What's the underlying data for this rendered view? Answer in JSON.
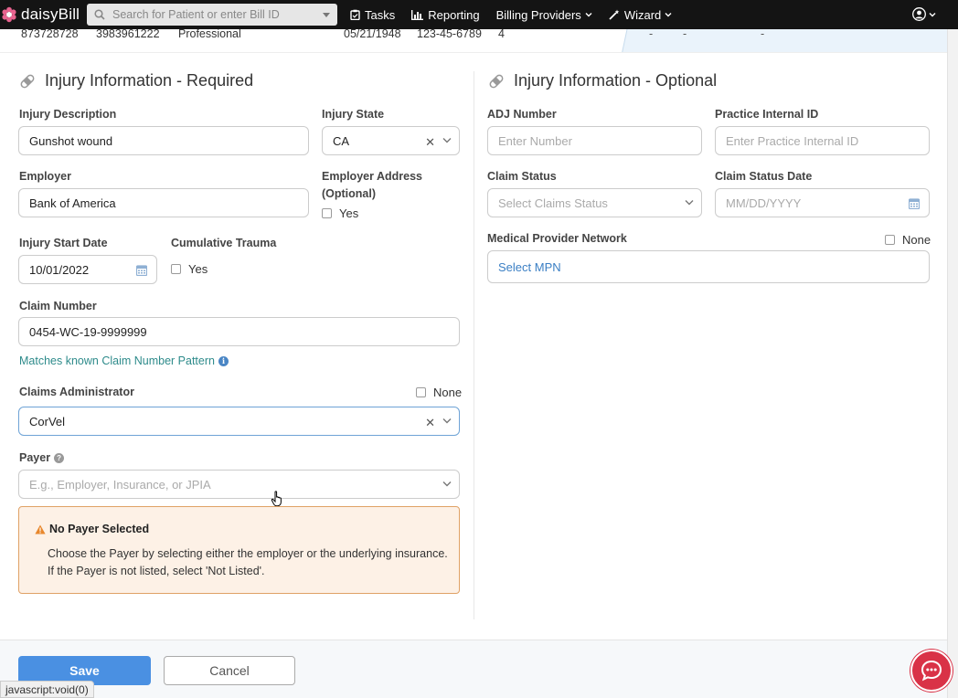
{
  "nav": {
    "brand": "daisyBill",
    "search_placeholder": "Search for Patient or enter Bill ID",
    "links": {
      "tasks": "Tasks",
      "reporting": "Reporting",
      "billing_providers": "Billing Providers",
      "wizard": "Wizard"
    }
  },
  "strip": {
    "cells": [
      "873728728",
      "3983961222",
      "Professional",
      "05/21/1948",
      "123-45-6789",
      "4"
    ],
    "dashes": [
      "-",
      "-",
      "-"
    ]
  },
  "required": {
    "title": "Injury Information - Required",
    "injury_description": {
      "label": "Injury Description",
      "value": "Gunshot wound"
    },
    "injury_state": {
      "label": "Injury State",
      "value": "CA"
    },
    "employer": {
      "label": "Employer",
      "value": "Bank of America"
    },
    "employer_address": {
      "label_line1": "Employer Address",
      "label_line2": "(Optional)",
      "checkbox": "Yes"
    },
    "injury_start_date": {
      "label": "Injury Start Date",
      "value": "10/01/2022"
    },
    "cumulative_trauma": {
      "label": "Cumulative Trauma",
      "checkbox": "Yes"
    },
    "claim_number": {
      "label": "Claim Number",
      "value": "0454-WC-19-9999999",
      "hint": "Matches known Claim Number Pattern"
    },
    "claims_administrator": {
      "label": "Claims Administrator",
      "value": "CorVel",
      "none_label": "None"
    },
    "payer": {
      "label": "Payer",
      "placeholder": "E.g., Employer, Insurance, or JPIA"
    },
    "warning": {
      "title": "No Payer Selected",
      "body": "Choose the Payer by selecting either the employer or the underlying insurance. If the Payer is not listed, select 'Not Listed'."
    }
  },
  "optional": {
    "title": "Injury Information - Optional",
    "adj_number": {
      "label": "ADJ Number",
      "placeholder": "Enter Number"
    },
    "practice_internal_id": {
      "label": "Practice Internal ID",
      "placeholder": "Enter Practice Internal ID"
    },
    "claim_status": {
      "label": "Claim Status",
      "placeholder": "Select Claims Status"
    },
    "claim_status_date": {
      "label": "Claim Status Date",
      "placeholder": "MM/DD/YYYY"
    },
    "mpn": {
      "label": "Medical Provider Network",
      "none_label": "None",
      "value": "Select MPN"
    }
  },
  "footer": {
    "save": "Save",
    "cancel": "Cancel",
    "status_text": "javascript:void(0)"
  },
  "colors": {
    "nav_bg": "#141414",
    "accent": "#4a90e2",
    "warning_bg": "#fdf1e6",
    "warning_border": "#e0a266",
    "chat": "#d93247",
    "link": "#2e8b8b"
  }
}
